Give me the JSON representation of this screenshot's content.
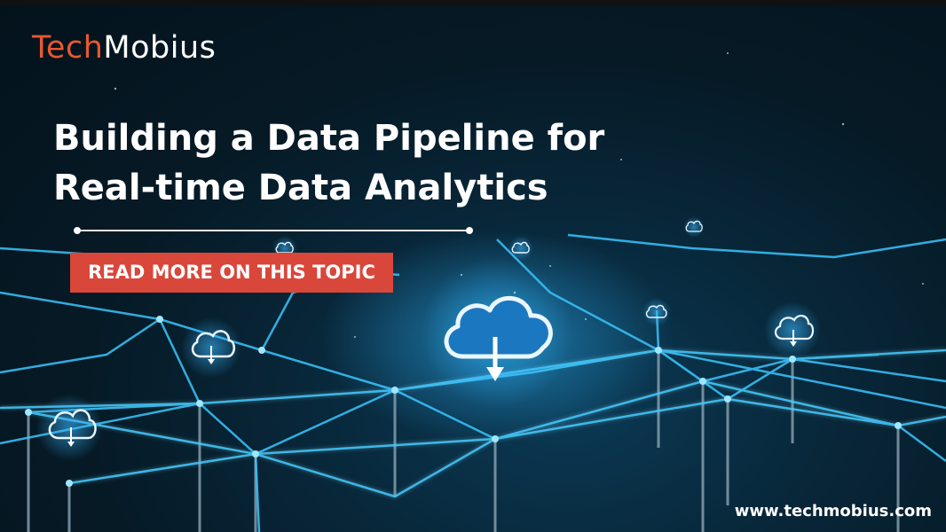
{
  "brand": {
    "logo_part1": "Tech",
    "logo_part2": "Mobius"
  },
  "headline": {
    "line1": "Building a Data Pipeline for",
    "line2": "Real-time Data Analytics"
  },
  "cta": {
    "label": "READ MORE ON THIS TOPIC"
  },
  "footer": {
    "url": "www.techmobius.com"
  },
  "colors": {
    "brand_orange": "#e8582f",
    "cta_red": "#d9473b",
    "network_glow": "#39c6ff",
    "text": "#ffffff"
  },
  "icons": [
    "cloud-download-icon"
  ]
}
